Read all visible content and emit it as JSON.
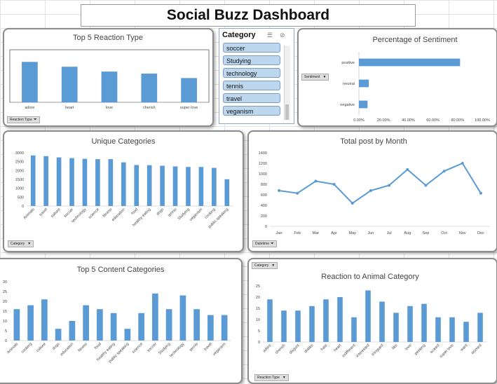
{
  "dashboard": {
    "title": "Social Buzz Dashboard"
  },
  "colors": {
    "bar": "#5b9bd5",
    "line": "#5b9bd5",
    "panel_border": "#8c8c8c",
    "slicer_item": "#bdd7ee"
  },
  "filters": {
    "reaction_type": "Reaction Type",
    "sentiment": "Sentiment",
    "category": "Category",
    "datetime": "Datetime",
    "category_top": "Category",
    "reaction_type_bottom": "Reaction Type"
  },
  "slicer": {
    "title": "Category",
    "items": [
      "soccer",
      "Studying",
      "technology",
      "tennis",
      "travel",
      "veganism"
    ]
  },
  "icons": {
    "multi_select": "multi-select-icon",
    "clear_filter": "clear-filter-icon",
    "filter": "filter-icon",
    "dropdown": "dropdown-arrow-icon"
  },
  "chart_data": [
    {
      "id": "top5reaction",
      "type": "bar",
      "title": "Top 5 Reaction Type",
      "categories": [
        "adore",
        "heart",
        "love",
        "cherish",
        "super love"
      ],
      "values": [
        100,
        88,
        76,
        71,
        60
      ],
      "ylim": [
        0,
        130
      ],
      "grid": false
    },
    {
      "id": "sentiment",
      "type": "bar",
      "orientation": "horizontal",
      "title": "Percentage of Sentiment",
      "categories": [
        "positive",
        "neutral",
        "negative"
      ],
      "values": [
        0.82,
        0.08,
        0.07
      ],
      "xlim": [
        0,
        1
      ],
      "xticks": [
        "0.00%",
        "20.00%",
        "40.00%",
        "60.00%",
        "80.00%",
        "100.00%"
      ],
      "grid": false
    },
    {
      "id": "unique",
      "type": "bar",
      "title": "Unique Categories",
      "categories": [
        "Animals",
        "travel",
        "culture",
        "soccer",
        "technology",
        "science",
        "fitness",
        "education",
        "food",
        "healthy eating",
        "dogs",
        "tennis",
        "Studying",
        "veganism",
        "cooking",
        "public speaking"
      ],
      "values": [
        2850,
        2810,
        2740,
        2700,
        2660,
        2640,
        2640,
        2460,
        2310,
        2300,
        2270,
        2230,
        2200,
        2200,
        2150,
        1510
      ],
      "ylim": [
        0,
        3000
      ],
      "yticks": [
        0,
        500,
        1000,
        1500,
        2000,
        2500,
        3000
      ],
      "grid": false
    },
    {
      "id": "monthly",
      "type": "line",
      "title": "Total post by Month",
      "categories": [
        "Jan",
        "Feb",
        "Mar",
        "Apr",
        "May",
        "Jun",
        "Jul",
        "Aug",
        "Sep",
        "Oct",
        "Nov",
        "Dec"
      ],
      "values": [
        680,
        630,
        860,
        800,
        440,
        680,
        780,
        1080,
        780,
        1050,
        1200,
        630
      ],
      "ylim": [
        0,
        1400
      ],
      "yticks": [
        0,
        200,
        400,
        600,
        800,
        1000,
        1200,
        1400
      ],
      "grid": false
    },
    {
      "id": "content5",
      "type": "bar",
      "title": "Top 5 Content Categories",
      "categories": [
        "Animals",
        "cooking",
        "culture",
        "dogs",
        "education",
        "fitness",
        "food",
        "healthy eating",
        "public speaking",
        "science",
        "soccer",
        "Studying",
        "technology",
        "tennis",
        "travel",
        "veganism"
      ],
      "values": [
        16,
        18,
        21,
        6,
        10,
        18,
        16,
        14,
        6,
        14,
        24,
        16,
        23,
        16,
        13,
        13
      ],
      "ylim": [
        0,
        30
      ],
      "yticks": [
        0,
        5,
        10,
        15,
        20,
        25,
        30
      ],
      "grid": false
    },
    {
      "id": "animal",
      "type": "bar",
      "title": "Reaction to Animal Category",
      "categories": [
        "adore",
        "cherish",
        "disgust",
        "dislike",
        "hate",
        "heart",
        "indifferent",
        "interested",
        "intrigued",
        "like",
        "love",
        "peeking",
        "scared",
        "super love",
        "want",
        "worried"
      ],
      "values": [
        19,
        14,
        14,
        16,
        19,
        20,
        11,
        23,
        18,
        13,
        16,
        17,
        11,
        11,
        9,
        13
      ],
      "ylim": [
        0,
        25
      ],
      "yticks": [
        0,
        5,
        10,
        15,
        20,
        25
      ],
      "grid": false
    }
  ]
}
